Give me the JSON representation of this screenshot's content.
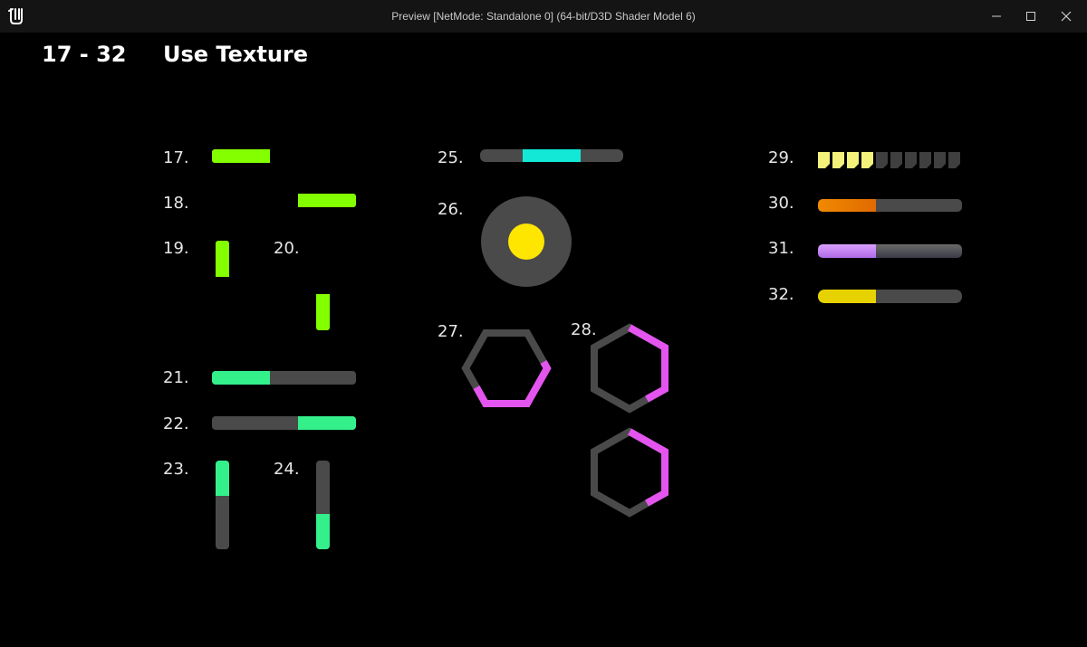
{
  "window": {
    "title": "Preview [NetMode: Standalone 0]  (64-bit/D3D Shader Model 6)",
    "minimize_icon": "minimize-icon",
    "maximize_icon": "maximize-icon",
    "close_icon": "close-icon",
    "logo_icon": "unreal-logo-icon"
  },
  "heading": {
    "range": "17  -  32",
    "title": "Use Texture"
  },
  "labels": {
    "l17": "17.",
    "l18": "18.",
    "l19": "19.",
    "l20": "20.",
    "l21": "21.",
    "l22": "22.",
    "l23": "23.",
    "l24": "24.",
    "l25": "25.",
    "l26": "26.",
    "l27": "27.",
    "l28": "28.",
    "l29": "29.",
    "l30": "30.",
    "l31": "31.",
    "l32": "32."
  },
  "progress": {
    "p21": 0.4,
    "p22": 0.4,
    "p23": 0.4,
    "p24": 0.4,
    "p25": 0.4,
    "p27": 0.4,
    "p28": 0.4,
    "p29_segments_filled": 4,
    "p29_segments_total": 10,
    "p30": 0.4,
    "p31": 0.4,
    "p32": 0.4
  },
  "colors": {
    "green": "#84ff00",
    "mint": "#33f08b",
    "cyan": "#13e8d6",
    "yellow": "#ffe600",
    "magenta": "#e455f0",
    "track": "#4a4a4a",
    "orange": "#f08a00",
    "lavender": "#c47cf2",
    "pale_yellow": "#f4f27a",
    "gold": "#e6d200"
  }
}
